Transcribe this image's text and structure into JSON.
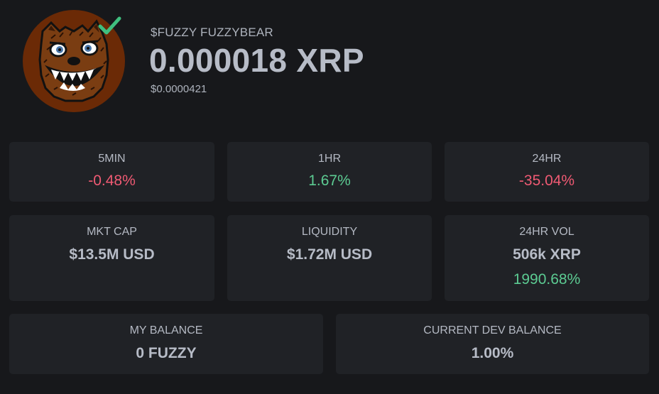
{
  "token": {
    "name": "$FUZZY FUZZYBEAR",
    "price_xrp": "0.000018 XRP",
    "price_usd": "$0.0000421",
    "avatar_icon": "fuzzy-bear-avatar",
    "verified_icon": "checkmark-icon",
    "verified_color": "#3fbf7f"
  },
  "changes": [
    {
      "label": "5MIN",
      "value": "-0.48%",
      "trend": "negative"
    },
    {
      "label": "1HR",
      "value": "1.67%",
      "trend": "positive"
    },
    {
      "label": "24HR",
      "value": "-35.04%",
      "trend": "negative"
    }
  ],
  "stats": {
    "market_cap": {
      "label": "MKT CAP",
      "value": "$13.5M USD"
    },
    "liquidity": {
      "label": "LIQUIDITY",
      "value": "$1.72M USD"
    },
    "volume": {
      "label": "24HR VOL",
      "value": "506k XRP",
      "change": "1990.68%"
    }
  },
  "balances": {
    "my_balance": {
      "label": "MY BALANCE",
      "value": "0 FUZZY"
    },
    "dev_balance": {
      "label": "CURRENT DEV BALANCE",
      "value": "1.00%"
    }
  },
  "colors": {
    "background": "#17181b",
    "card": "#202226",
    "negative": "#ef5a73",
    "positive": "#5ccb92",
    "text": "#b7bcc7"
  }
}
